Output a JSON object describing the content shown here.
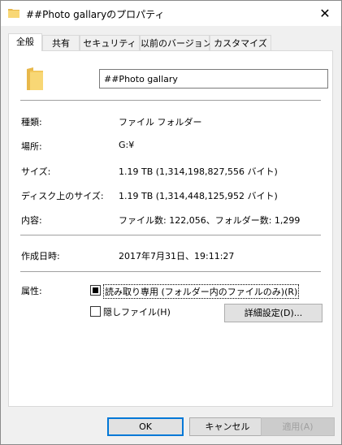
{
  "window": {
    "title": "##Photo gallaryのプロパティ",
    "close_glyph": "✕"
  },
  "tabs": [
    {
      "label": "全般",
      "active": true
    },
    {
      "label": "共有",
      "active": false
    },
    {
      "label": "セキュリティ",
      "active": false
    },
    {
      "label": "以前のバージョン",
      "active": false
    },
    {
      "label": "カスタマイズ",
      "active": false
    }
  ],
  "general": {
    "name_value": "##Photo gallary",
    "rows": [
      {
        "label": "種類:",
        "value": "ファイル フォルダー"
      },
      {
        "label": "場所:",
        "value": "G:¥"
      },
      {
        "label": "サイズ:",
        "value": "1.19 TB (1,314,198,827,556 バイト)"
      },
      {
        "label": "ディスク上のサイズ:",
        "value": "1.19 TB (1,314,448,125,952 バイト)"
      },
      {
        "label": "内容:",
        "value": "ファイル数: 122,056、フォルダー数: 1,299"
      },
      {
        "label": "作成日時:",
        "value": "2017年7月31日、19:11:27"
      }
    ],
    "attributes_label": "属性:",
    "readonly_label": "読み取り専用 (フォルダー内のファイルのみ)(R)",
    "readonly_checked": true,
    "hidden_label": "隠しファイル(H)",
    "hidden_checked": false,
    "advanced_label": "詳細設定(D)..."
  },
  "footer": {
    "ok_label": "OK",
    "cancel_label": "キャンセル",
    "apply_label": "適用(A)"
  },
  "colors": {
    "folder_yellow": "#f8d775",
    "folder_dark": "#e8b84a",
    "accent": "#0078d7"
  },
  "icons": {
    "title": "folder-icon",
    "main": "folder-icon",
    "close": "close-icon"
  }
}
